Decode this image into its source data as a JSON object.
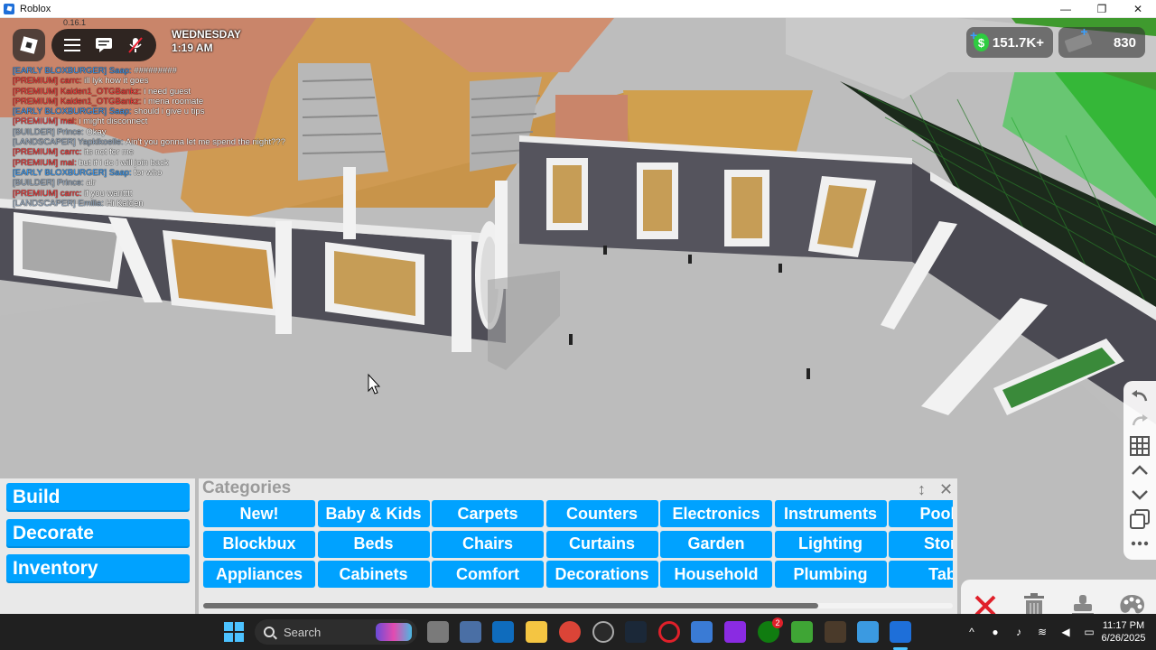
{
  "window": {
    "title": "Roblox",
    "minimize": "—",
    "maximize": "❐",
    "close": "✕"
  },
  "hud": {
    "version": "0.16.1",
    "day": "WEDNESDAY",
    "time": "1:19 AM",
    "money": "151.7K+",
    "blockbux": "830"
  },
  "chat": [
    {
      "tag": "[EARLY BLOXBURGER] Saap:",
      "tag_color": "#3aa0ff",
      "text": "#########"
    },
    {
      "tag": "[PREMIUM] carrc:",
      "tag_color": "#ff3b3b",
      "text": "ill lyk how it goes"
    },
    {
      "tag": "[PREMIUM] Kaiden1_OTGBankz:",
      "tag_color": "#ff3b3b",
      "text": "i need guest"
    },
    {
      "tag": "[PREMIUM] Kaiden1_OTGBankz:",
      "tag_color": "#ff3b3b",
      "text": "i mena roomate"
    },
    {
      "tag": "[EARLY BLOXBURGER] Saap:",
      "tag_color": "#3aa0ff",
      "text": "should i give u tips"
    },
    {
      "tag": "[PREMIUM] mal:",
      "tag_color": "#ff3b3b",
      "text": "i might disconnect"
    },
    {
      "tag": "[BUILDER] Prince:",
      "tag_color": "#9bb0c8",
      "text": "Okay"
    },
    {
      "tag": "[LANDSCAPER] Yapkikoelle:",
      "tag_color": "#9bb0c8",
      "text": "Ain't you gonna let me spend the night???"
    },
    {
      "tag": "[PREMIUM] carrc:",
      "tag_color": "#ff3b3b",
      "text": "its not for me"
    },
    {
      "tag": "[PREMIUM] mal:",
      "tag_color": "#ff3b3b",
      "text": "but if i do i will join back"
    },
    {
      "tag": "[EARLY BLOXBURGER] Saap:",
      "tag_color": "#3aa0ff",
      "text": "for who"
    },
    {
      "tag": "[BUILDER] Prince:",
      "tag_color": "#9bb0c8",
      "text": "alr"
    },
    {
      "tag": "[PREMIUM] carrc:",
      "tag_color": "#ff3b3b",
      "text": "if you wantttt"
    },
    {
      "tag": "[LANDSCAPER] Emilia:",
      "tag_color": "#9bb0c8",
      "text": "Hi Kaiden"
    }
  ],
  "menu": {
    "build": "Build",
    "decorate": "Decorate",
    "inventory": "Inventory"
  },
  "categories": {
    "title": "Categories",
    "resize_icon": "↕",
    "close_icon": "✕",
    "rows": [
      [
        "New!",
        "Baby & Kids",
        "Carpets",
        "Counters",
        "Electronics",
        "Instruments",
        "Pool It"
      ],
      [
        "Blockbux",
        "Beds",
        "Chairs",
        "Curtains",
        "Garden",
        "Lighting",
        "Stora"
      ],
      [
        "Appliances",
        "Cabinets",
        "Comfort",
        "Decorations",
        "Household",
        "Plumbing",
        "Tabl"
      ]
    ],
    "scroll_fraction": 0.82
  },
  "taskbar": {
    "search_placeholder": "Search",
    "time": "11:17 PM",
    "date": "6/26/2025",
    "xbox_badge": "2"
  },
  "colors": {
    "accent": "#00a2ff",
    "panel": "#e9e9e9",
    "taskbar": "#202020"
  }
}
